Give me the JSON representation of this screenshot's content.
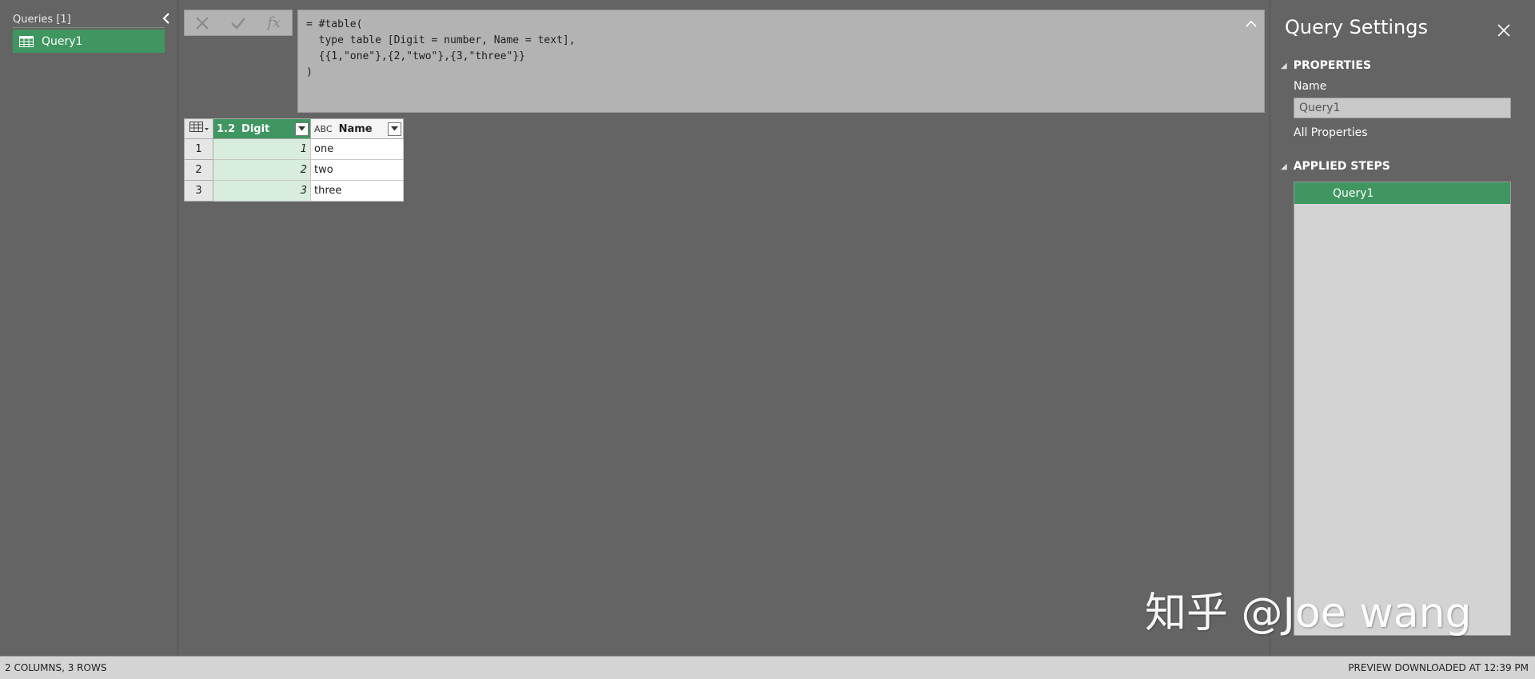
{
  "queries_pane": {
    "header": "Queries [1]",
    "items": [
      {
        "label": "Query1"
      }
    ]
  },
  "formula_bar": {
    "fx_label": "fx",
    "formula": "= #table(\n  type table [Digit = number, Name = text],\n  {{1,\"one\"},{2,\"two\"},{3,\"three\"}}\n)"
  },
  "grid": {
    "columns": [
      {
        "type_label": "1.2",
        "name": "Digit"
      },
      {
        "type_label": "ABC",
        "name": "Name"
      }
    ],
    "rows": [
      {
        "num": "1",
        "digit": "1",
        "name": "one"
      },
      {
        "num": "2",
        "digit": "2",
        "name": "two"
      },
      {
        "num": "3",
        "digit": "3",
        "name": "three"
      }
    ]
  },
  "settings": {
    "title": "Query Settings",
    "properties_header": "PROPERTIES",
    "name_label": "Name",
    "name_value": "Query1",
    "all_properties": "All Properties",
    "applied_steps_header": "APPLIED STEPS",
    "steps": [
      {
        "label": "Query1"
      }
    ]
  },
  "watermark": "知乎 @Joe wang",
  "status": {
    "left": "2 COLUMNS, 3 ROWS",
    "right": "PREVIEW DOWNLOADED AT 12:39 PM"
  },
  "colors": {
    "accent_green": "#3f9660",
    "background": "#646464",
    "digit_cell": "#d8eddd"
  }
}
